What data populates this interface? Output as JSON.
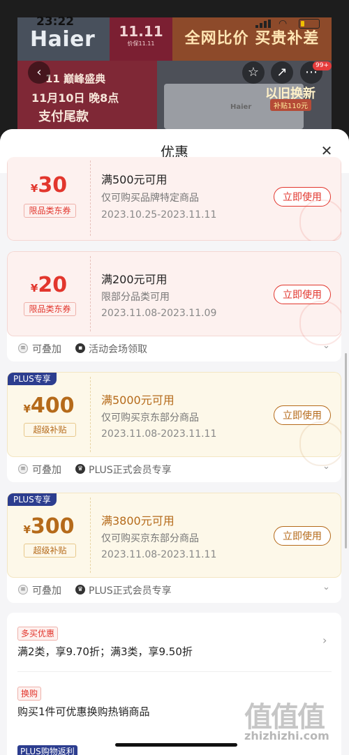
{
  "status_bar": {
    "time": "23:22"
  },
  "banner": {
    "logo": "Haier",
    "event_big": "11.11",
    "event_small": "价保11.11",
    "compare_text": "全网比价 买贵补差",
    "peak_text": "11 巅峰盛典",
    "date_text": "11月10日 晚8点",
    "pay_text": "支付尾款",
    "heater_label": "Haier",
    "trade_in": "以旧换新",
    "subsidy": "补贴110元",
    "badge_count": "99+"
  },
  "sheet": {
    "title": "优惠",
    "close_icon": "close-icon"
  },
  "coupons": [
    {
      "currency": "¥",
      "amount": "30",
      "tag": "限品类东券",
      "title": "满500元可用",
      "desc": "仅可购买品牌特定商品",
      "date": "2023.10.25-2023.11.11",
      "button": "立即使用",
      "style": "red"
    },
    {
      "currency": "¥",
      "amount": "20",
      "tag": "限品类东券",
      "title": "满200元可用",
      "desc": "限部分品类可用",
      "date": "2023.11.08-2023.11.09",
      "button": "立即使用",
      "style": "red",
      "footer": {
        "stackable": "可叠加",
        "source": "活动会场领取"
      }
    },
    {
      "plus_badge": "PLUS专享",
      "currency": "¥",
      "amount": "400",
      "tag": "超级补贴",
      "title": "满5000元可用",
      "desc": "仅可购买京东部分商品",
      "date": "2023.11.08-2023.11.11",
      "button": "立即使用",
      "style": "gold",
      "footer": {
        "stackable": "可叠加",
        "source": "PLUS正式会员专享"
      }
    },
    {
      "plus_badge": "PLUS专享",
      "currency": "¥",
      "amount": "300",
      "tag": "超级补贴",
      "title": "满3800元可用",
      "desc": "仅可购买京东部分商品",
      "date": "2023.11.08-2023.11.11",
      "button": "立即使用",
      "style": "gold",
      "footer": {
        "stackable": "可叠加",
        "source": "PLUS正式会员专享"
      }
    }
  ],
  "promotions": [
    {
      "tag": "多买优惠",
      "text": "满2类，享9.70折；满3类，享9.50折"
    },
    {
      "tag": "换购",
      "text": "购买1件可优惠换购热销商品"
    },
    {
      "tag": "PLUS购物返利"
    }
  ],
  "watermark": {
    "text": "值值值",
    "site": "zhizhizhi.com"
  },
  "colors": {
    "coupon_red": "#e2362d",
    "coupon_gold": "#b56a1a",
    "plus_blue": "#2c3d8f"
  }
}
